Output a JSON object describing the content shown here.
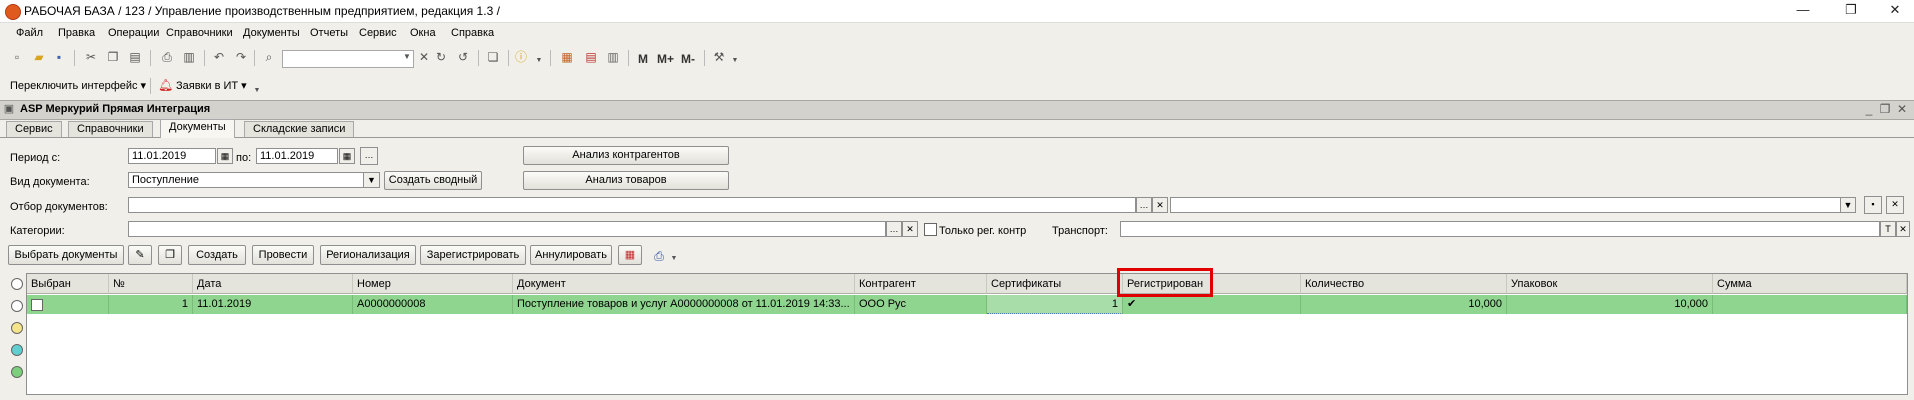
{
  "window": {
    "title": "РАБОЧАЯ БАЗА / 123 /  Управление производственным предприятием, редакция 1.3 /",
    "minimize": "—",
    "restore": "❐",
    "close": "✕"
  },
  "menu": [
    "Файл",
    "Правка",
    "Операции",
    "Справочники",
    "Документы",
    "Отчеты",
    "Сервис",
    "Окна",
    "Справка"
  ],
  "toolbar": {
    "m": "M",
    "mplus": "M+",
    "mminus": "M-",
    "switch_interface": "Переключить интерфейс ▾",
    "it_requests": "Заявки в ИТ ▾"
  },
  "form": {
    "title": "ASP Меркурий Прямая Интеграция",
    "tabs": [
      "Сервис",
      "Справочники",
      "Документы",
      "Складские записи"
    ],
    "active_tab": 2,
    "period_from_label": "Период с:",
    "period_from": "11.01.2019",
    "period_to_label": "по:",
    "period_to": "11.01.2019",
    "doc_type_label": "Вид документа:",
    "doc_type": "Поступление",
    "create_summary": "Создать сводный",
    "analysis_contractors": "Анализ контрагентов",
    "analysis_goods": "Анализ товаров",
    "doc_filter_label": "Отбор документов:",
    "categories_label": "Категории:",
    "only_reg_label": "Только рег. контр",
    "transport_label": "Транспорт:"
  },
  "actions": {
    "select_docs": "Выбрать документы",
    "create": "Создать",
    "post": "Провести",
    "regionalization": "Регионализация",
    "register": "Зарегистрировать",
    "cancel": "Аннулировать"
  },
  "grid": {
    "columns": [
      "Выбран",
      "№",
      "Дата",
      "Номер",
      "Документ",
      "Контрагент",
      "Сертификаты",
      "Регистрирован",
      "Количество",
      "Упаковок",
      "Сумма"
    ],
    "rows": [
      {
        "num": "1",
        "date": "11.01.2019",
        "number": "А0000000008",
        "document": "Поступление товаров и услуг А0000000008 от 11.01.2019 14:33...",
        "contractor": "ООО Рус",
        "certs": "1",
        "registered": "✔",
        "quantity": "10,000",
        "packs": "10,000",
        "sum": ""
      }
    ]
  }
}
